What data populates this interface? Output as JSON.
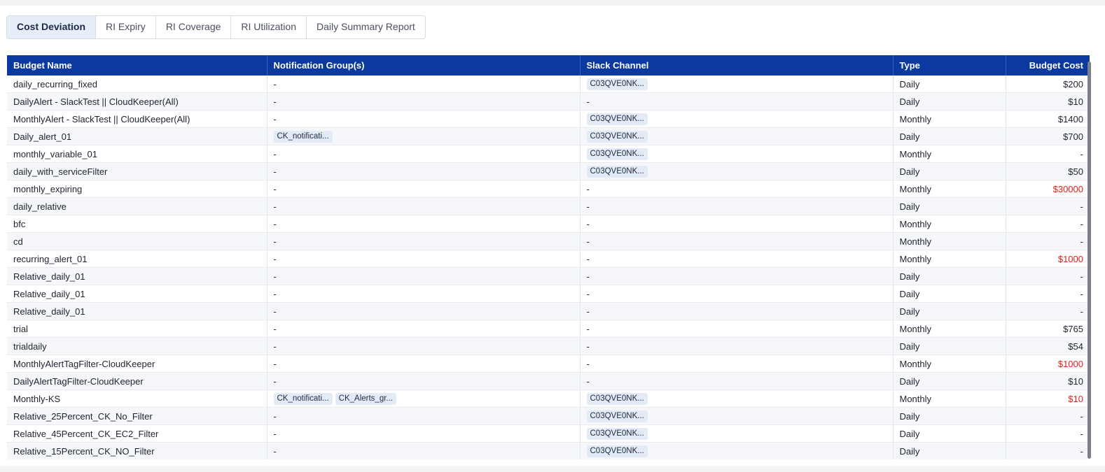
{
  "tabs": [
    {
      "label": "Cost Deviation",
      "active": true
    },
    {
      "label": "RI Expiry",
      "active": false
    },
    {
      "label": "RI Coverage",
      "active": false
    },
    {
      "label": "RI Utilization",
      "active": false
    },
    {
      "label": "Daily Summary Report",
      "active": false
    }
  ],
  "table": {
    "headers": [
      "Budget Name",
      "Notification Group(s)",
      "Slack Channel",
      "Type",
      "Budget Cost"
    ],
    "rows": [
      {
        "name": "daily_recurring_fixed",
        "groups": [],
        "slack": "C03QVE0NK...",
        "type": "Daily",
        "cost": "$200",
        "cost_red": false
      },
      {
        "name": "DailyAlert - SlackTest || CloudKeeper(All)",
        "groups": [],
        "slack": "",
        "type": "Daily",
        "cost": "$10",
        "cost_red": false
      },
      {
        "name": "MonthlyAlert - SlackTest || CloudKeeper(All)",
        "groups": [],
        "slack": "C03QVE0NK...",
        "type": "Monthly",
        "cost": "$1400",
        "cost_red": false
      },
      {
        "name": "Daily_alert_01",
        "groups": [
          "CK_notificati..."
        ],
        "slack": "C03QVE0NK...",
        "type": "Daily",
        "cost": "$700",
        "cost_red": false
      },
      {
        "name": "monthly_variable_01",
        "groups": [],
        "slack": "C03QVE0NK...",
        "type": "Monthly",
        "cost": "-",
        "cost_red": false
      },
      {
        "name": "daily_with_serviceFilter",
        "groups": [],
        "slack": "C03QVE0NK...",
        "type": "Daily",
        "cost": "$50",
        "cost_red": false
      },
      {
        "name": "monthly_expiring",
        "groups": [],
        "slack": "",
        "type": "Monthly",
        "cost": "$30000",
        "cost_red": true
      },
      {
        "name": "daily_relative",
        "groups": [],
        "slack": "",
        "type": "Daily",
        "cost": "-",
        "cost_red": false
      },
      {
        "name": "bfc",
        "groups": [],
        "slack": "",
        "type": "Monthly",
        "cost": "-",
        "cost_red": false
      },
      {
        "name": "cd",
        "groups": [],
        "slack": "",
        "type": "Monthly",
        "cost": "-",
        "cost_red": false
      },
      {
        "name": "recurring_alert_01",
        "groups": [],
        "slack": "",
        "type": "Monthly",
        "cost": "$1000",
        "cost_red": true
      },
      {
        "name": "Relative_daily_01",
        "groups": [],
        "slack": "",
        "type": "Daily",
        "cost": "-",
        "cost_red": false
      },
      {
        "name": "Relative_daily_01",
        "groups": [],
        "slack": "",
        "type": "Daily",
        "cost": "-",
        "cost_red": false
      },
      {
        "name": "Relative_daily_01",
        "groups": [],
        "slack": "",
        "type": "Daily",
        "cost": "-",
        "cost_red": false
      },
      {
        "name": "trial",
        "groups": [],
        "slack": "",
        "type": "Monthly",
        "cost": "$765",
        "cost_red": false
      },
      {
        "name": "trialdaily",
        "groups": [],
        "slack": "",
        "type": "Daily",
        "cost": "$54",
        "cost_red": false
      },
      {
        "name": "MonthlyAlertTagFilter-CloudKeeper",
        "groups": [],
        "slack": "",
        "type": "Monthly",
        "cost": "$1000",
        "cost_red": true
      },
      {
        "name": "DailyAlertTagFilter-CloudKeeper",
        "groups": [],
        "slack": "",
        "type": "Daily",
        "cost": "$10",
        "cost_red": false
      },
      {
        "name": "Monthly-KS",
        "groups": [
          "CK_notificati...",
          "CK_Alerts_gr..."
        ],
        "slack": "C03QVE0NK...",
        "type": "Monthly",
        "cost": "$10",
        "cost_red": true
      },
      {
        "name": "Relative_25Percent_CK_No_Filter",
        "groups": [],
        "slack": "C03QVE0NK...",
        "type": "Daily",
        "cost": "-",
        "cost_red": false
      },
      {
        "name": "Relative_45Percent_CK_EC2_Filter",
        "groups": [],
        "slack": "C03QVE0NK...",
        "type": "Daily",
        "cost": "-",
        "cost_red": false
      },
      {
        "name": "Relative_15Percent_CK_NO_Filter",
        "groups": [],
        "slack": "C03QVE0NK...",
        "type": "Daily",
        "cost": "-",
        "cost_red": false
      }
    ],
    "empty_value": "-"
  },
  "colors": {
    "header_bg": "#0a3aa0",
    "accent_red": "#e0211b",
    "chip_bg": "#e3ebf7"
  }
}
